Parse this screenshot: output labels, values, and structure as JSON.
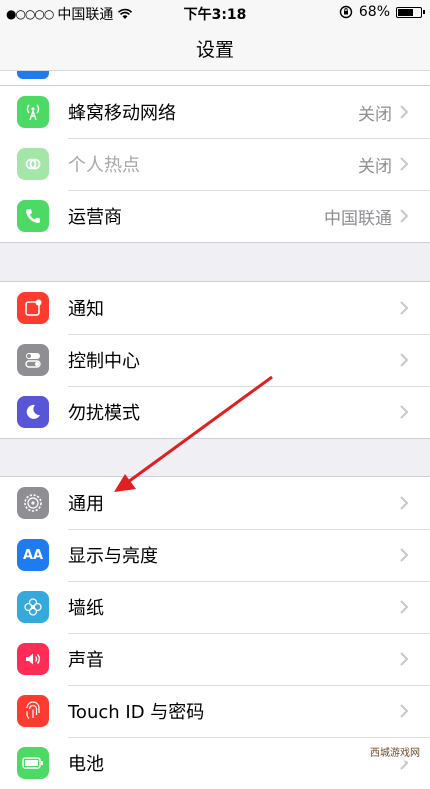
{
  "status_bar": {
    "signal_dots": "●○○○○",
    "carrier": "中国联通",
    "time": "下午3:18",
    "battery": "68%",
    "battery_level": 0.68
  },
  "nav": {
    "title": "设置"
  },
  "groups": [
    [
      {
        "id": "cellular",
        "label": "蜂窝移动网络",
        "value": "关闭",
        "icon": "cellular-antenna-icon",
        "color": "#4cd964",
        "dim": false
      },
      {
        "id": "hotspot",
        "label": "个人热点",
        "value": "关闭",
        "icon": "personal-hotspot-icon",
        "color": "#a4e5a8",
        "dim": true
      },
      {
        "id": "carrier",
        "label": "运营商",
        "value": "中国联通",
        "icon": "phone-icon",
        "color": "#4cd964",
        "dim": false
      }
    ],
    [
      {
        "id": "notifications",
        "label": "通知",
        "value": "",
        "icon": "notifications-icon",
        "color": "#ff3b30",
        "dim": false
      },
      {
        "id": "control-center",
        "label": "控制中心",
        "value": "",
        "icon": "control-center-icon",
        "color": "#8e8e93",
        "dim": false
      },
      {
        "id": "do-not-disturb",
        "label": "勿扰模式",
        "value": "",
        "icon": "moon-icon",
        "color": "#5856d6",
        "dim": false
      }
    ],
    [
      {
        "id": "general",
        "label": "通用",
        "value": "",
        "icon": "gear-icon",
        "color": "#8e8e93",
        "dim": false
      },
      {
        "id": "display",
        "label": "显示与亮度",
        "value": "",
        "icon": "text-size-icon",
        "color": "#1e7bf0",
        "dim": false
      },
      {
        "id": "wallpaper",
        "label": "墙纸",
        "value": "",
        "icon": "wallpaper-flower-icon",
        "color": "#34aadc",
        "dim": false
      },
      {
        "id": "sounds",
        "label": "声音",
        "value": "",
        "icon": "speaker-icon",
        "color": "#ff2d55",
        "dim": false
      },
      {
        "id": "touch-id",
        "label": "Touch ID 与密码",
        "value": "",
        "icon": "fingerprint-icon",
        "color": "#ff3b30",
        "dim": false
      },
      {
        "id": "battery",
        "label": "电池",
        "value": "",
        "icon": "battery-icon",
        "color": "#4cd964",
        "dim": false
      }
    ]
  ],
  "display_icon_text": "AA",
  "annotation": {
    "color": "#e02020"
  },
  "watermark": "西城游戏网"
}
